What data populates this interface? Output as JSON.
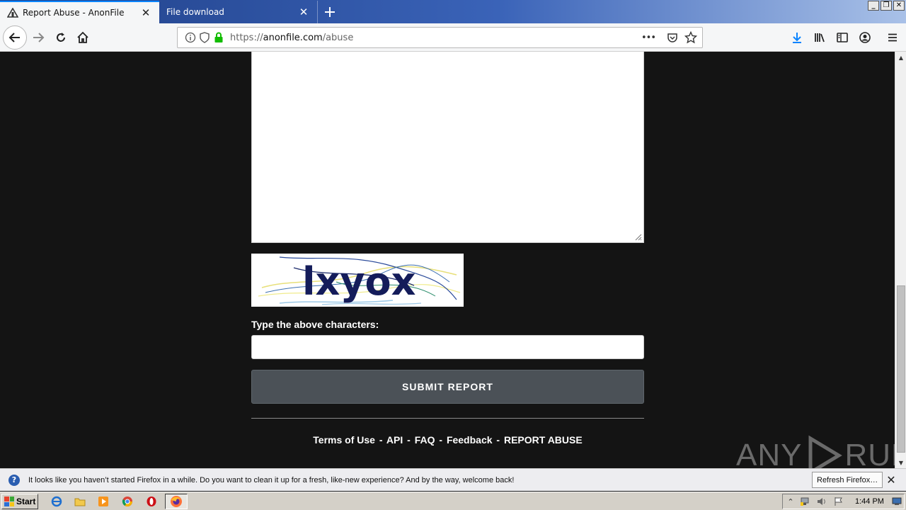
{
  "browser": {
    "tabs": [
      {
        "title": "Report Abuse - AnonFile",
        "active": true,
        "favicon": "anonfile-favicon"
      },
      {
        "title": "File download",
        "active": false,
        "favicon": "none"
      }
    ],
    "new_tab_icon": "plus-icon",
    "close_glyph": "✕",
    "window_buttons": [
      "_",
      "❐",
      "✕"
    ],
    "url": {
      "scheme": "https://",
      "host": "anonfile.com",
      "path": "/abuse"
    },
    "url_actions_glyph": "•••",
    "accent_color": "#0a84ff"
  },
  "page": {
    "captcha_text": "lxyox",
    "captcha_label": "Type the above characters:",
    "captcha_value": "",
    "submit_label": "SUBMIT REPORT",
    "footer_links": [
      "Terms of Use",
      "API",
      "FAQ",
      "Feedback",
      "REPORT ABUSE"
    ],
    "footer_separator": "-",
    "background_color": "#141414",
    "button_color": "#4b5157"
  },
  "watermark": {
    "left": "ANY",
    "right": "RUN"
  },
  "notification": {
    "message": "It looks like you haven’t started Firefox in a while. Do you want to clean it up for a fresh, like-new experience? And by the way, welcome back!",
    "button": "Refresh Firefox…",
    "close_glyph": "✕"
  },
  "taskbar": {
    "start_label": "Start",
    "clock": "1:44 PM",
    "apps": [
      "internet-explorer-icon",
      "folder-icon",
      "media-player-icon",
      "chrome-icon",
      "opera-icon",
      "firefox-icon"
    ]
  }
}
